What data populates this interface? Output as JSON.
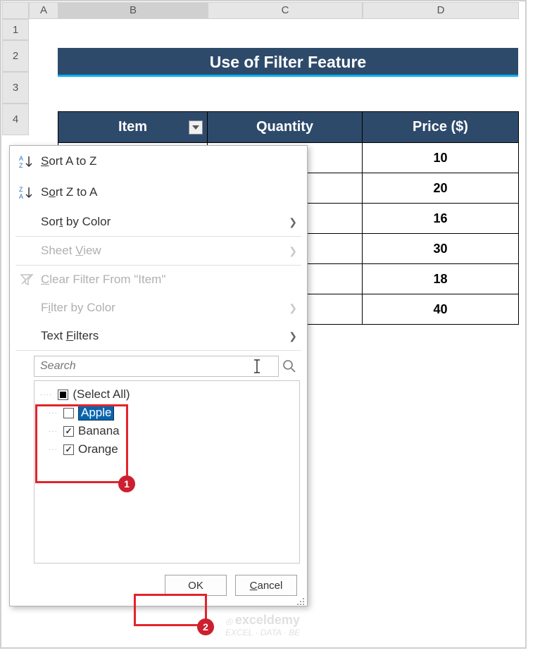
{
  "columns": [
    "A",
    "B",
    "C",
    "D"
  ],
  "rows": [
    "1",
    "2",
    "3",
    "4"
  ],
  "title": "Use of Filter Feature",
  "table": {
    "headers": {
      "item": "Item",
      "quantity": "Quantity",
      "price": "Price ($)"
    },
    "price_values": [
      "10",
      "20",
      "16",
      "30",
      "18",
      "40"
    ]
  },
  "menu": {
    "sort_az": "Sort A to Z",
    "sort_za": "Sort Z to A",
    "sort_color": "Sort by Color",
    "sheet_view": "Sheet View",
    "clear_filter": "Clear Filter From \"Item\"",
    "filter_color": "Filter by Color",
    "text_filters": "Text Filters",
    "search_placeholder": "Search",
    "items": {
      "select_all": "(Select All)",
      "apple": "Apple",
      "banana": "Banana",
      "orange": "Orange"
    },
    "ok": "OK",
    "cancel": "Cancel"
  },
  "callouts": {
    "c1": "1",
    "c2": "2"
  },
  "watermark": {
    "brand": "exceldemy",
    "tag": "EXCEL · DATA · BE"
  },
  "chart_data": {
    "type": "table",
    "title": "Use of Filter Feature",
    "columns": [
      "Item",
      "Quantity",
      "Price ($)"
    ],
    "visible_rows": [
      {
        "Item": null,
        "Quantity": null,
        "Price ($)": 10
      },
      {
        "Item": null,
        "Quantity": null,
        "Price ($)": 20
      },
      {
        "Item": null,
        "Quantity": null,
        "Price ($)": 16
      },
      {
        "Item": null,
        "Quantity": null,
        "Price ($)": 30
      },
      {
        "Item": null,
        "Quantity": null,
        "Price ($)": 18
      },
      {
        "Item": null,
        "Quantity": null,
        "Price ($)": 40
      }
    ],
    "filter_dropdown": {
      "column": "Item",
      "options": [
        "(Select All)",
        "Apple",
        "Banana",
        "Orange"
      ],
      "checked": {
        "(Select All)": "partial",
        "Apple": false,
        "Banana": true,
        "Orange": true
      }
    }
  }
}
